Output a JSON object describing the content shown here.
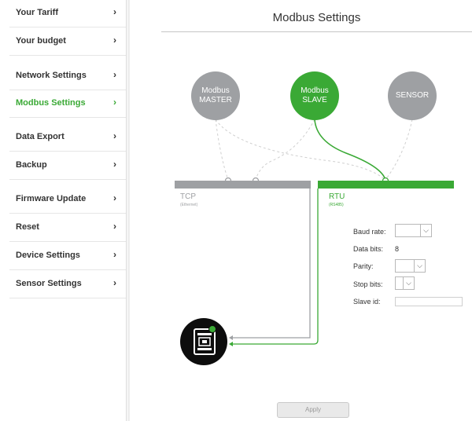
{
  "sidebar": {
    "items": [
      {
        "label": "Your Tariff",
        "chevron": "›"
      },
      {
        "label": "Your budget",
        "chevron": "›"
      },
      {
        "label": "Network Settings",
        "chevron": "›"
      },
      {
        "label": "Modbus Settings",
        "chevron": "›",
        "active": true
      },
      {
        "label": "Data Export",
        "chevron": "›"
      },
      {
        "label": "Backup",
        "chevron": "›"
      },
      {
        "label": "Firmware Update",
        "chevron": "›"
      },
      {
        "label": "Reset",
        "chevron": "›"
      },
      {
        "label": "Device Settings",
        "chevron": "›"
      },
      {
        "label": "Sensor Settings",
        "chevron": "›"
      }
    ]
  },
  "main": {
    "title": "Modbus Settings",
    "nodes": {
      "master": {
        "line1": "Modbus",
        "line2": "MASTER"
      },
      "slave": {
        "line1": "Modbus",
        "line2": "SLAVE"
      },
      "sensor": {
        "label": "SENSOR"
      }
    },
    "tcp": {
      "label": "TCP",
      "sub": "(Ethernet)"
    },
    "rtu": {
      "label": "RTU",
      "sub": "(RS485)"
    },
    "form": {
      "baud_rate_label": "Baud rate:",
      "data_bits_label": "Data bits:",
      "data_bits_value": "8",
      "parity_label": "Parity:",
      "stop_bits_label": "Stop bits:",
      "slave_id_label": "Slave id:",
      "slave_id_value": ""
    },
    "apply_label": "Apply",
    "colors": {
      "accent": "#3aa935",
      "grey": "#9ea0a3",
      "text": "#333333"
    }
  }
}
